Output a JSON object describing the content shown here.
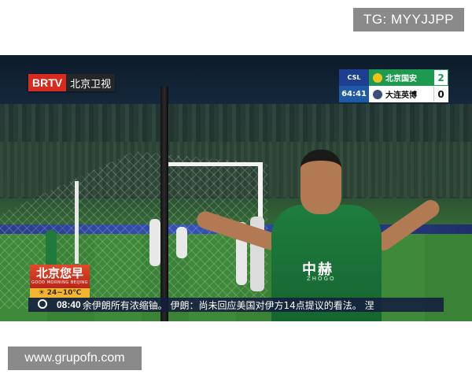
{
  "watermarks": {
    "top_right": "TG: MYYJJPP",
    "bottom_left": "www.grupofn.com"
  },
  "channel": {
    "brand": "BRTV",
    "name": "北京卫视"
  },
  "scoreboard": {
    "league": "CSL",
    "clock": "64:41",
    "home": {
      "team": "北京国安",
      "score": "2"
    },
    "away": {
      "team": "大连英博",
      "score": "0"
    }
  },
  "player": {
    "sponsor": "中赫",
    "sponsor_sub": "ZHOGO"
  },
  "news": {
    "logo_title": "北京您早",
    "logo_sub": "GOOD MORNING BEIJING",
    "weather_icon": "sun-icon",
    "weather": "24~10℃",
    "time": "08:40",
    "ticker": "余伊朗所有浓缩铀。   伊朗：尚未回应美国对伊方14点提议的看法。  涅"
  },
  "colors": {
    "brtv_red": "#d62b1e",
    "home_green": "#1c9a4f",
    "league_blue": "#1d3f8f",
    "weather_yellow": "#f2b531"
  }
}
